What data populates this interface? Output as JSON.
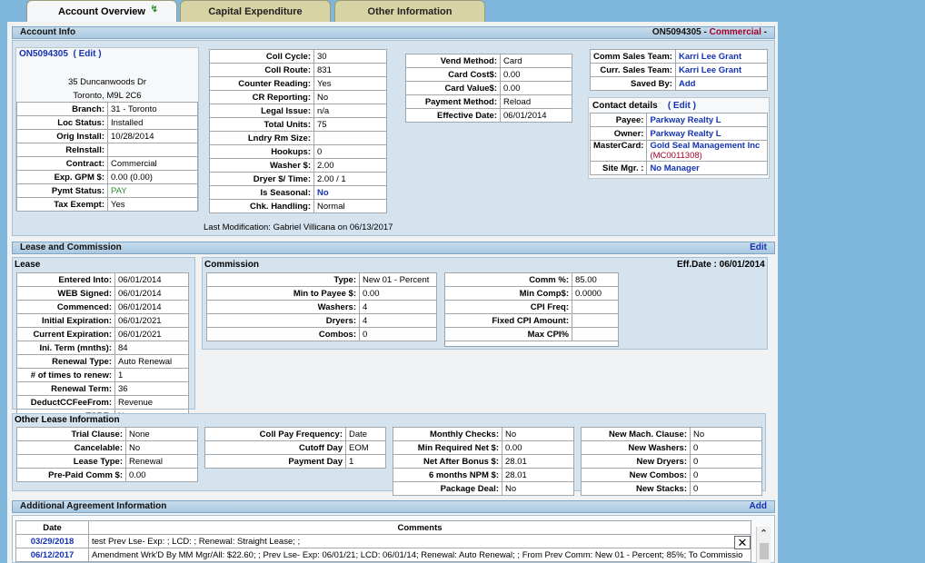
{
  "tabs": [
    {
      "label": "Account Overview"
    },
    {
      "label": "Capital Expenditure"
    },
    {
      "label": "Other Information"
    }
  ],
  "account_info": {
    "title": "Account Info",
    "header_right_id": "ON5094305",
    "header_right_sep": " - ",
    "header_right_type": "Commercial",
    "header_right_tail": " -",
    "account_id": "ON5094305",
    "edit_label": "( Edit )",
    "address1": "35 Duncanwoods Dr",
    "address2": "Toronto,  M9L 2C6",
    "fields_left": [
      {
        "k": "Branch:",
        "v": "31 - Toronto"
      },
      {
        "k": "Loc Status:",
        "v": "Installed"
      },
      {
        "k": "Orig Install:",
        "v": "10/28/2014"
      },
      {
        "k": "ReInstall:",
        "v": ""
      },
      {
        "k": "Contract:",
        "v": "Commercial"
      },
      {
        "k": "Exp. GPM $:",
        "v": "0.00  (0.00)"
      },
      {
        "k": "Pymt Status:",
        "v": "PAY"
      },
      {
        "k": "Tax Exempt:",
        "v": "Yes"
      }
    ],
    "fields_mid": [
      {
        "k": "Coll Cycle:",
        "v": "30"
      },
      {
        "k": "Coll Route:",
        "v": "831"
      },
      {
        "k": "Counter Reading:",
        "v": "Yes"
      },
      {
        "k": "CR Reporting:",
        "v": "No"
      },
      {
        "k": "Legal Issue:",
        "v": "n/a"
      },
      {
        "k": "Total Units:",
        "v": "75"
      },
      {
        "k": "Lndry Rm Size:",
        "v": ""
      },
      {
        "k": "Hookups:",
        "v": "0"
      },
      {
        "k": "Washer $:",
        "v": "2.00"
      },
      {
        "k": "Dryer $/ Time:",
        "v": "2.00 / 1"
      },
      {
        "k": "Is Seasonal:",
        "v": "No"
      },
      {
        "k": "Chk. Handling:",
        "v": "Normal"
      }
    ],
    "fields_vend": [
      {
        "k": "Vend Method:",
        "v": "Card"
      },
      {
        "k": "Card Cost$:",
        "v": "0.00"
      },
      {
        "k": "Card Value$:",
        "v": "0.00"
      },
      {
        "k": "Payment Method:",
        "v": "Reload"
      },
      {
        "k": "Effective Date:",
        "v": "06/01/2014"
      }
    ],
    "fields_sales": [
      {
        "k": "Comm Sales Team:",
        "v": "Karri Lee Grant"
      },
      {
        "k": "Curr. Sales Team:",
        "v": "Karri Lee Grant"
      },
      {
        "k": "Saved By:",
        "v": "Add"
      }
    ],
    "contact_title": "Contact details",
    "contact_edit": "( Edit )",
    "fields_contact": [
      {
        "k": "Payee:",
        "v": "Parkway Realty L"
      },
      {
        "k": "Owner:",
        "v": "Parkway Realty L"
      },
      {
        "k": "MasterCard:",
        "v": "Gold Seal Management Inc",
        "v2": "(MC0011308)"
      },
      {
        "k": "Site Mgr. :",
        "v": "No Manager"
      }
    ],
    "last_modification": "Last Modification: Gabriel Villicana on 06/13/2017"
  },
  "lease": {
    "title": "Lease and Commission",
    "edit_label": "Edit",
    "lease_label": "Lease",
    "commission_label": "Commission",
    "eff_date": "Eff.Date : 06/01/2014",
    "fields_lease": [
      {
        "k": "Entered Into:",
        "v": "06/01/2014"
      },
      {
        "k": "WEB Signed:",
        "v": "06/01/2014"
      },
      {
        "k": "Commenced:",
        "v": "06/01/2014"
      },
      {
        "k": "Initial Expiration:",
        "v": "06/01/2021"
      },
      {
        "k": "Current Expiration:",
        "v": "06/01/2021"
      },
      {
        "k": "Ini. Term (mnths):",
        "v": "84"
      },
      {
        "k": "Renewal Type:",
        "v": "Auto Renewal"
      },
      {
        "k": "# of times to renew:",
        "v": "1"
      },
      {
        "k": "Renewal Term:",
        "v": "36"
      },
      {
        "k": "DeductCCFeeFrom:",
        "v": "Revenue"
      },
      {
        "k": "TSRE:",
        "v": "No"
      }
    ],
    "fields_comm1": [
      {
        "k": "Type:",
        "v": "New 01 - Percent"
      },
      {
        "k": "Min to Payee $:",
        "v": "0.00"
      },
      {
        "k": "Washers:",
        "v": "4"
      },
      {
        "k": "Dryers:",
        "v": "4"
      },
      {
        "k": "Combos:",
        "v": "0"
      }
    ],
    "fields_comm2": [
      {
        "k": "Comm %:",
        "v": "85.00"
      },
      {
        "k": "Min Comp$:",
        "v": "0.0000"
      },
      {
        "k": "CPI Freq:",
        "v": ""
      },
      {
        "k": "Fixed CPI Amount:",
        "v": ""
      },
      {
        "k": "Max CPI%",
        "v": ""
      }
    ],
    "other_label": "Other Lease Information",
    "fields_o1": [
      {
        "k": "Trial Clause:",
        "v": "None"
      },
      {
        "k": "Cancelable:",
        "v": "No"
      },
      {
        "k": "Lease Type:",
        "v": "Renewal"
      },
      {
        "k": "Pre-Paid Comm $:",
        "v": "0.00"
      }
    ],
    "fields_o2": [
      {
        "k": "Coll Pay Frequency:",
        "v": "Date"
      },
      {
        "k": "Cutoff Day",
        "v": "EOM"
      },
      {
        "k": "Payment Day",
        "v": "1"
      }
    ],
    "fields_o3": [
      {
        "k": "Monthly Checks:",
        "v": "No"
      },
      {
        "k": "Min Required Net $:",
        "v": "0.00"
      },
      {
        "k": "Net After Bonus $:",
        "v": "28.01"
      },
      {
        "k": "6 months NPM $:",
        "v": "28.01"
      },
      {
        "k": "Package Deal:",
        "v": "No"
      }
    ],
    "fields_o4": [
      {
        "k": "New Mach. Clause:",
        "v": "No"
      },
      {
        "k": "New Washers:",
        "v": "0"
      },
      {
        "k": "New Dryers:",
        "v": "0"
      },
      {
        "k": "New Combos:",
        "v": "0"
      },
      {
        "k": "New Stacks:",
        "v": "0"
      }
    ]
  },
  "agreement": {
    "title": "Additional Agreement Information",
    "add_label": "Add",
    "col_date": "Date",
    "col_comments": "Comments",
    "rows": [
      {
        "date": "03/29/2018",
        "comment": "test Prev Lse- Exp: ; LCD: ; Renewal: Straight Lease; ;"
      },
      {
        "date": "06/12/2017",
        "comment": "Amendment Wrk'D By MM Mgr/All: $22.60; ; Prev Lse- Exp: 06/01/21; LCD: 06/01/14; Renewal: Auto Renewal; ; From Prev Comm: New 01 - Percent; 85%; To Commissio"
      }
    ]
  }
}
